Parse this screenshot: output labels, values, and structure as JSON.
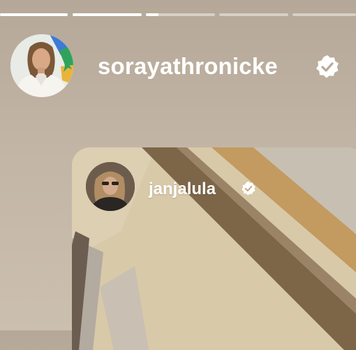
{
  "story": {
    "progress": [
      {
        "filled": 1
      },
      {
        "filled": 1
      },
      {
        "filled": 0.18
      },
      {
        "filled": 0
      },
      {
        "filled": 0
      }
    ]
  },
  "header": {
    "username": "sorayathronicke",
    "verified": true,
    "avatar_icon": "profile-photo"
  },
  "shared_post": {
    "username": "janjalula",
    "verified": true,
    "avatar_icon": "profile-photo"
  },
  "colors": {
    "background": "#c2b5a5",
    "progress_track": "rgba(255,255,255,0.45)",
    "progress_fill": "#ffffff",
    "text": "#ffffff"
  }
}
